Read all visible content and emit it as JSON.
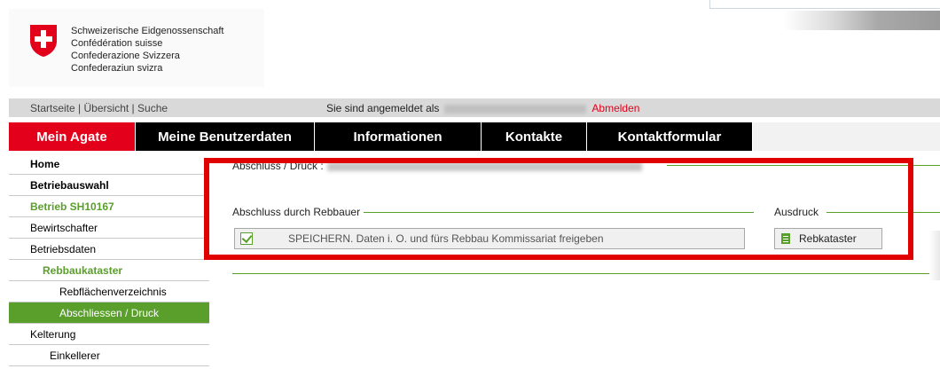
{
  "header": {
    "conf_lines": [
      "Schweizerische Eidgenossenschaft",
      "Confédération suisse",
      "Confederazione Svizzera",
      "Confederaziun svizra"
    ]
  },
  "topnav": {
    "startseite": "Startseite",
    "uebersicht": "Übersicht",
    "suche": "Suche",
    "separator": "|",
    "login_prefix": "Sie sind angemeldet als",
    "logout": "Abmelden"
  },
  "mainmenu": {
    "items": [
      {
        "label": "Mein Agate"
      },
      {
        "label": "Meine Benutzerdaten"
      },
      {
        "label": "Informationen"
      },
      {
        "label": "Kontakte"
      },
      {
        "label": "Kontaktformular"
      }
    ]
  },
  "sidebar": {
    "items": [
      {
        "label": "Home"
      },
      {
        "label": "Betriebauswahl"
      },
      {
        "label": "Betrieb SH10167"
      },
      {
        "label": "Bewirtschafter"
      },
      {
        "label": "Betriebsdaten"
      },
      {
        "label": "Rebbaukataster"
      },
      {
        "label": "Rebflächenverzeichnis"
      },
      {
        "label": "Abschliessen / Druck"
      },
      {
        "label": "Kelterung"
      },
      {
        "label": "Einkellerer"
      }
    ]
  },
  "content": {
    "title_prefix": "Abschluss / Druck :",
    "section_abschluss": "Abschluss durch Rebbauer",
    "section_ausdruck": "Ausdruck",
    "save_button": "SPEICHERN. Daten i. O. und fürs Rebbau Kommissariat freigeben",
    "rebkataster_button": "Rebkataster"
  },
  "colors": {
    "accent_red": "#e2001a",
    "nav_green": "#5a9e2c",
    "menu_black": "#000000",
    "highlight_frame": "#e00000"
  }
}
